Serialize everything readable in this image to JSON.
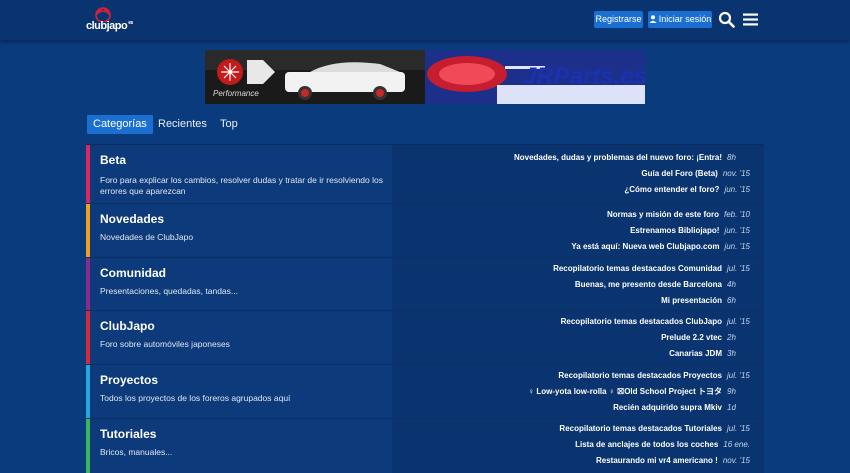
{
  "header": {
    "logo_text": "clubjapo",
    "logo_suffix": "es",
    "register_label": "Registrarse",
    "login_label": "Iniciar sesión",
    "search_icon": "search-icon",
    "menu_icon": "hamburger-menu-icon"
  },
  "banner": {
    "left_text": "Performance",
    "right_text": "JRParts.es"
  },
  "tabs": [
    {
      "label": "Categorías",
      "active": true
    },
    {
      "label": "Recientes",
      "active": false
    },
    {
      "label": "Top",
      "active": false
    }
  ],
  "categories": [
    {
      "name": "Beta",
      "description": "Foro para explicar los cambios, resolver dudas y tratar de ir resolviendo los errores que aparezcan",
      "color": "#e0245e",
      "topics": [
        {
          "title": "Novedades, dudas y problemas del nuevo foro: ¡Entra!",
          "date": "8h"
        },
        {
          "title": "Guía del Foro (Beta)",
          "date": "nov. '15"
        },
        {
          "title": "¿Cómo entender el foro?",
          "date": "jun. '15"
        }
      ]
    },
    {
      "name": "Novedades",
      "description": "Novedades de ClubJapo",
      "color": "#f0a020",
      "topics": [
        {
          "title": "Normas y misión de este foro",
          "date": "feb. '10"
        },
        {
          "title": "Estrenamos Bibliojapo!",
          "date": "jun. '15"
        },
        {
          "title": "Ya está aquí: Nueva web Clubjapo.com",
          "date": "jun. '15"
        }
      ]
    },
    {
      "name": "Comunidad",
      "description": "Presentaciones, quedadas, tandas...",
      "color": "#8c2a8c",
      "topics": [
        {
          "title": "Recopilatorio temas destacados Comunidad",
          "date": "jul. '15"
        },
        {
          "title": "Buenas, me presento desde Barcelona",
          "date": "4h"
        },
        {
          "title": "Mi presentación",
          "date": "6h"
        }
      ]
    },
    {
      "name": "ClubJapo",
      "description": "Foro sobre automóviles japoneses",
      "color": "#d42a3c",
      "topics": [
        {
          "title": "Recopilatorio temas destacados ClubJapo",
          "date": "jul. '15"
        },
        {
          "title": "Prelude 2.2 vtec",
          "date": "2h"
        },
        {
          "title": "Canarias JDM",
          "date": "3h"
        }
      ]
    },
    {
      "name": "Proyectos",
      "description": "Todos los proyectos de los foreros agrupados aquí",
      "color": "#29a6e0",
      "topics": [
        {
          "title": "Recopilatorio temas destacados Proyectos",
          "date": "jul. '15"
        },
        {
          "title": "♀ Low-yota low-rolla ♀ ☒Old School Project トヨタ",
          "date": "9h"
        },
        {
          "title": "Recién adquirido supra Mkiv",
          "date": "1d"
        }
      ]
    },
    {
      "name": "Tutoriales",
      "description": "Bricos, manuales...",
      "color": "#3cb45a",
      "topics": [
        {
          "title": "Recopilatorio temas destacados Tutoriales",
          "date": "jul. '15"
        },
        {
          "title": "Lista de anclajes de todos los coches",
          "date": "16 ene."
        },
        {
          "title": "Restaurando mi vr4 americano !",
          "date": "nov. '15"
        }
      ]
    }
  ]
}
